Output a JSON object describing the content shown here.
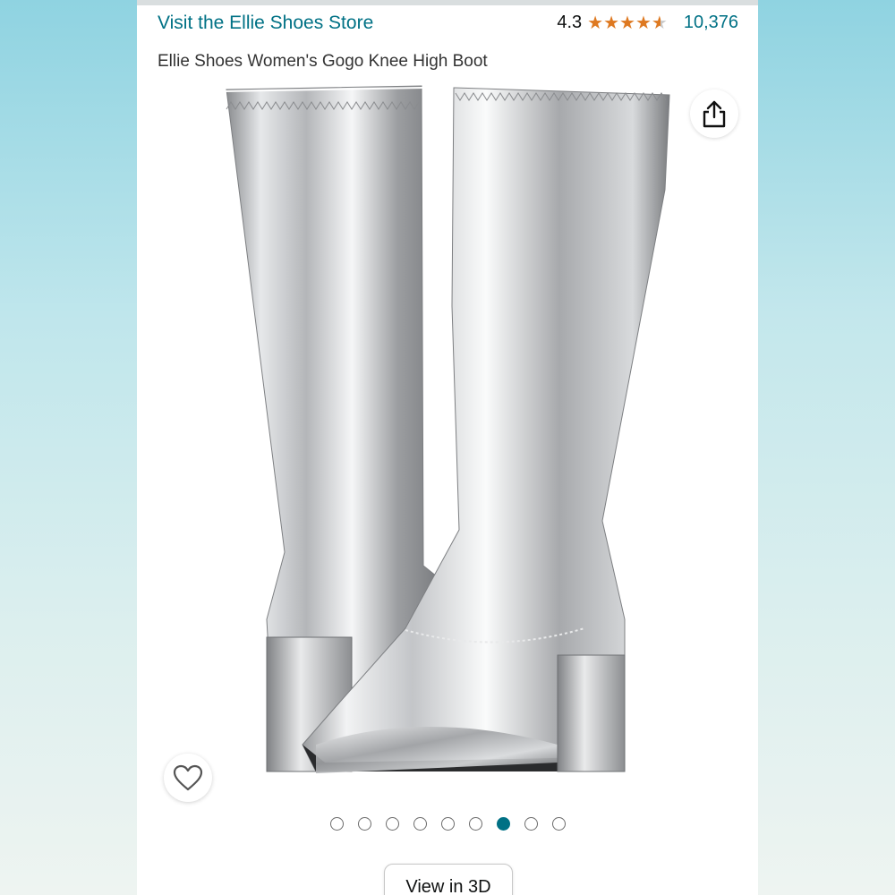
{
  "header": {
    "store_link": "Visit the Ellie Shoes Store",
    "rating_value": "4.3",
    "rating_stars": 4.3,
    "review_count": "10,376",
    "product_title": "Ellie Shoes Women's Gogo Knee High Boot"
  },
  "colors": {
    "link": "#007185",
    "star": "#de7921",
    "active_dot": "#007185"
  },
  "icons": {
    "share": "share-icon",
    "favorite": "heart-icon"
  },
  "carousel": {
    "total": 9,
    "active_index": 6
  },
  "actions": {
    "view_3d": "View in 3D"
  }
}
